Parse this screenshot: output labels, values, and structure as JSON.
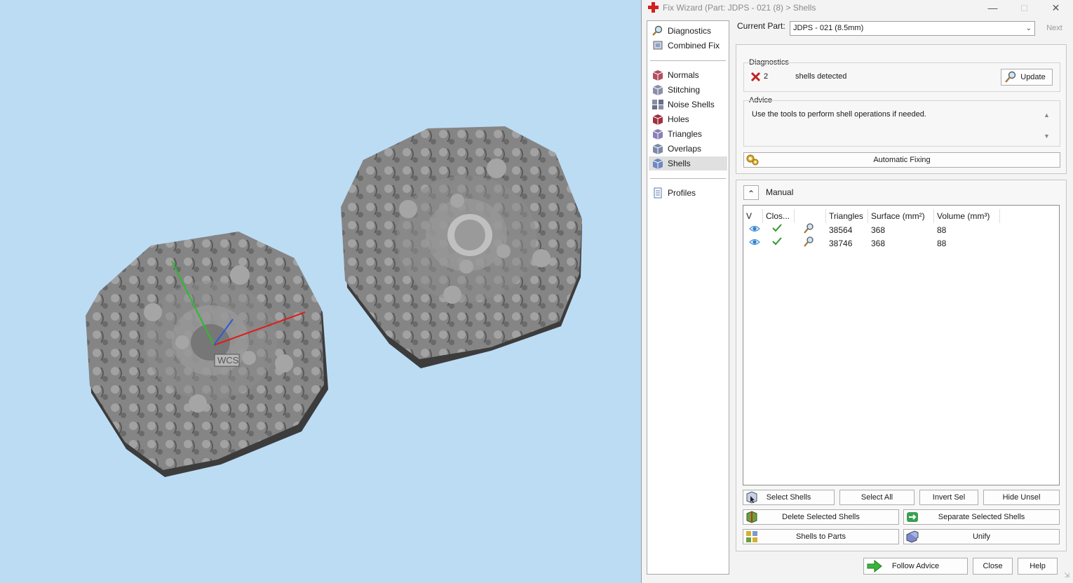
{
  "window": {
    "title": "Fix Wizard (Part: JDPS - 021 (8) > Shells",
    "controls": [
      "—",
      "□",
      "✕"
    ]
  },
  "viewport": {
    "axis_label": "WCS"
  },
  "nav": {
    "items": [
      {
        "label": "Diagnostics",
        "icon": "magnifier-icon"
      },
      {
        "label": "Combined Fix",
        "icon": "combined-fix-icon"
      },
      {
        "label": "Normals",
        "icon": "normals-icon"
      },
      {
        "label": "Stitching",
        "icon": "stitching-icon"
      },
      {
        "label": "Noise Shells",
        "icon": "noise-shells-icon"
      },
      {
        "label": "Holes",
        "icon": "holes-icon"
      },
      {
        "label": "Triangles",
        "icon": "triangles-icon"
      },
      {
        "label": "Overlaps",
        "icon": "overlaps-icon"
      },
      {
        "label": "Shells",
        "icon": "shells-icon"
      },
      {
        "label": "Profiles",
        "icon": "profiles-icon"
      }
    ],
    "selected": "Shells"
  },
  "current_part": {
    "label": "Current Part:",
    "value": "JDPS - 021 (8.5mm)",
    "next_label": "Next"
  },
  "diagnostics": {
    "title": "Diagnostics",
    "count": "2",
    "message": "shells detected",
    "update_label": "Update"
  },
  "advice": {
    "title": "Advice",
    "text": "Use the tools to perform shell operations if needed."
  },
  "automatic_fixing_label": "Automatic Fixing",
  "manual": {
    "title": "Manual",
    "collapse_glyph": "⌃"
  },
  "table": {
    "columns": [
      "V",
      "Clos...",
      "",
      "Triangles",
      "Surface (mm²)",
      "Volume (mm³)"
    ],
    "rows": [
      {
        "triangles": "38564",
        "surface": "368",
        "volume": "88"
      },
      {
        "triangles": "38746",
        "surface": "368",
        "volume": "88"
      }
    ]
  },
  "buttons": {
    "select_shells": "Select Shells",
    "select_all": "Select All",
    "invert_sel": "Invert Sel",
    "hide_unsel": "Hide Unsel",
    "delete_selected": "Delete Selected Shells",
    "separate_selected": "Separate Selected Shells",
    "shells_to_parts": "Shells to Parts",
    "unify": "Unify",
    "follow_advice": "Follow Advice",
    "close": "Close",
    "help": "Help"
  },
  "colors": {
    "viewport_bg": "#bcdcf4",
    "mesh_gray": "#7d7d7d",
    "brand_red": "#d21f1f",
    "check_green": "#2e9a2e",
    "eye_blue": "#2f7fd0"
  }
}
